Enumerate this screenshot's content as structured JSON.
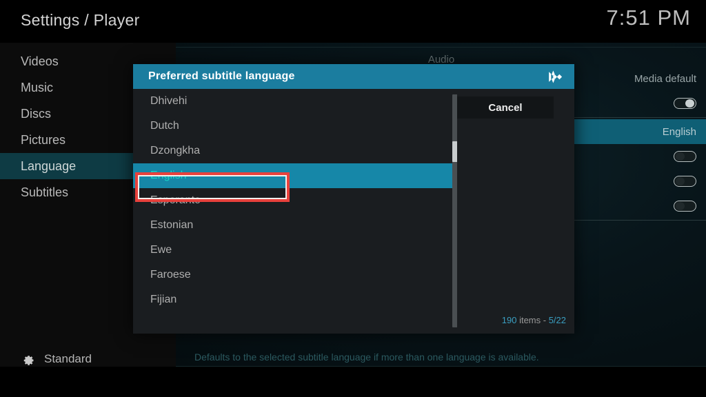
{
  "header": {
    "title": "Settings / Player",
    "clock": "7:51 PM"
  },
  "sidebar": {
    "items": [
      {
        "label": "Videos",
        "active": false
      },
      {
        "label": "Music",
        "active": false
      },
      {
        "label": "Discs",
        "active": false
      },
      {
        "label": "Pictures",
        "active": false
      },
      {
        "label": "Language",
        "active": true
      },
      {
        "label": "Subtitles",
        "active": false
      }
    ],
    "profile": {
      "icon": "gear-icon",
      "label": "Standard"
    }
  },
  "background": {
    "category_label": "Audio",
    "settings": [
      {
        "type": "label",
        "label": "Media default"
      },
      {
        "type": "toggle",
        "state": "on"
      },
      {
        "type": "divider"
      },
      {
        "type": "value",
        "label": "English",
        "highlight": true
      },
      {
        "type": "toggle",
        "state": "off"
      },
      {
        "type": "toggle",
        "state": "off"
      },
      {
        "type": "toggle",
        "state": "off"
      },
      {
        "type": "divider"
      }
    ],
    "help_text": "Defaults to the selected subtitle language if more than one language is available."
  },
  "dialog": {
    "title": "Preferred subtitle language",
    "logo_icon": "kodi-logo-icon",
    "cancel_label": "Cancel",
    "item_count_prefix": "190",
    "item_count_middle": " items - ",
    "item_count_position": "5/22",
    "items": [
      {
        "label": "Dhivehi",
        "selected": false
      },
      {
        "label": "Dutch",
        "selected": false
      },
      {
        "label": "Dzongkha",
        "selected": false
      },
      {
        "label": "English",
        "selected": true
      },
      {
        "label": "Esperanto",
        "selected": false
      },
      {
        "label": "Estonian",
        "selected": false
      },
      {
        "label": "Ewe",
        "selected": false
      },
      {
        "label": "Faroese",
        "selected": false
      },
      {
        "label": "Fijian",
        "selected": false
      }
    ]
  },
  "annotation": {
    "highlight_color": "#e8413c",
    "target": "English"
  },
  "colors": {
    "accent_teal": "#1b7d9f",
    "selected_row": "#1687a8",
    "selected_text": "#19d6c9",
    "sidebar_active": "#0e3b44",
    "help_text": "#2c5a60"
  }
}
